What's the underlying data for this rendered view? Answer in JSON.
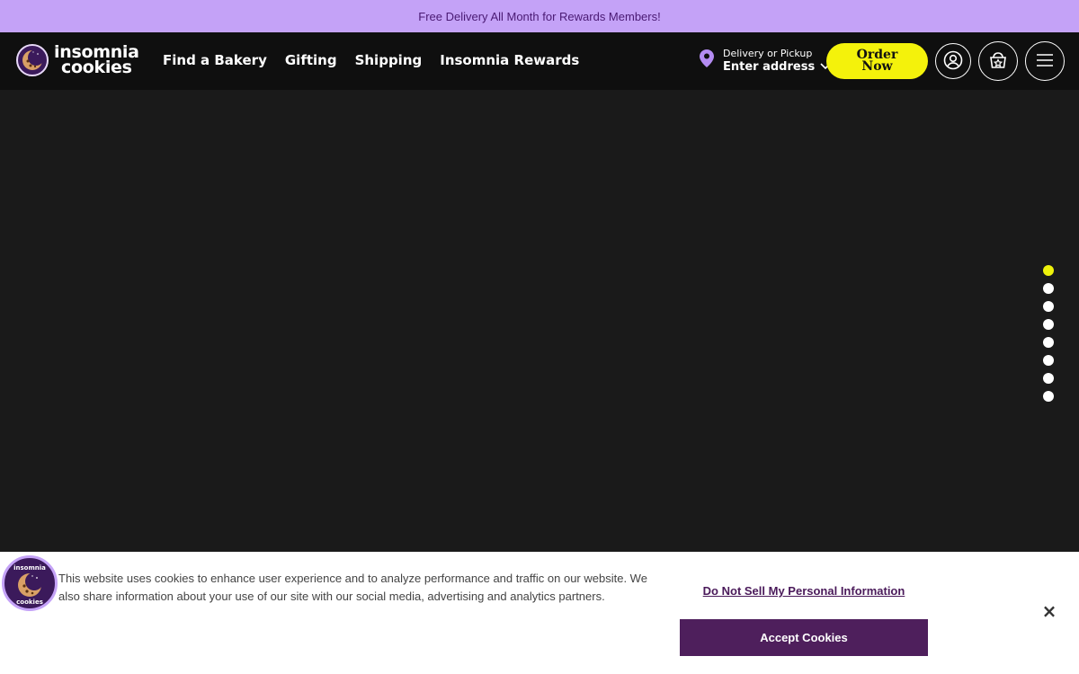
{
  "promo": {
    "text": "Free Delivery All Month for Rewards Members!"
  },
  "header": {
    "logo": {
      "line1": "insomnia",
      "line2": "cookies"
    },
    "nav": [
      "Find a Bakery",
      "Gifting",
      "Shipping",
      "Insomnia Rewards"
    ],
    "delivery": {
      "sub": "Delivery or Pickup",
      "main": "Enter address"
    },
    "order_now": {
      "line1": "Order",
      "line2": "Now"
    }
  },
  "carousel": {
    "slide_count": 8,
    "active_index": 0
  },
  "cookie_banner": {
    "logo": {
      "line1": "insomnia",
      "line2": "cookies"
    },
    "text": "This website uses cookies to enhance user experience and to analyze performance and traffic on our website. We also share information about your use of our site with our social media, advertising and analytics partners.",
    "do_not_sell": "Do Not Sell My Personal Information",
    "accept": "Accept Cookies",
    "close": "×"
  },
  "colors": {
    "promo_bg": "#c4a2f7",
    "accent_yellow": "#f4f20b",
    "accept_bg": "#4e1f5c",
    "location_pin": "#b48cf2"
  }
}
